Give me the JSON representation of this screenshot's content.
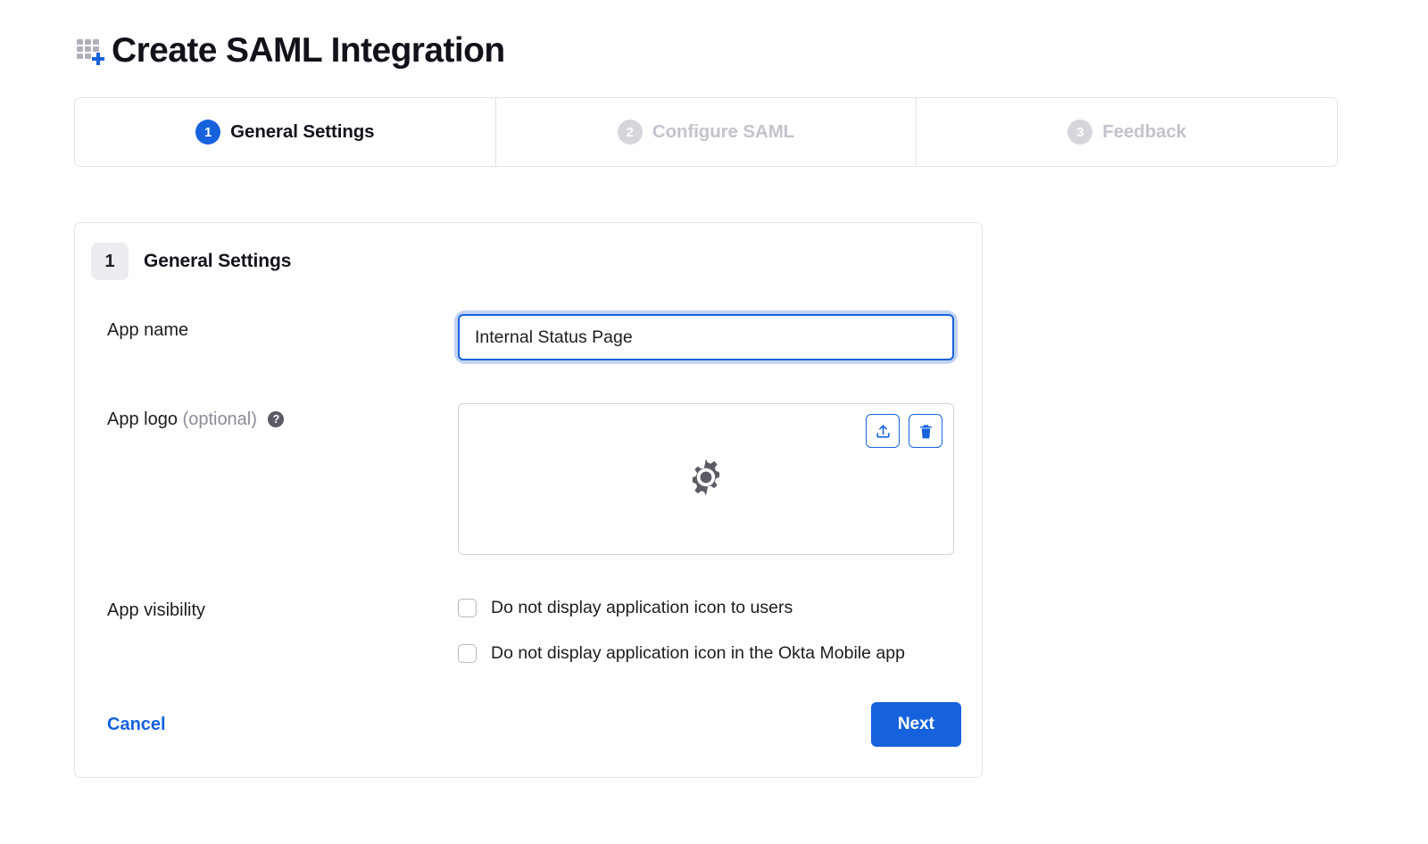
{
  "header": {
    "icon": "app-add-grid-icon",
    "title": "Create SAML Integration"
  },
  "stepper": {
    "tabs": [
      {
        "number": "1",
        "label": "General Settings",
        "active": true
      },
      {
        "number": "2",
        "label": "Configure SAML",
        "active": false
      },
      {
        "number": "3",
        "label": "Feedback",
        "active": false
      }
    ]
  },
  "card": {
    "step_number": "1",
    "step_title": "General Settings",
    "app_name": {
      "label": "App name",
      "value": "Internal Status Page",
      "placeholder": ""
    },
    "app_logo": {
      "label": "App logo",
      "optional_text": "(optional)",
      "help_icon": "help-circle-icon",
      "help_glyph": "?",
      "upload_icon": "upload-icon",
      "delete_icon": "trash-icon",
      "placeholder_icon": "gear-icon"
    },
    "app_visibility": {
      "label": "App visibility",
      "options": [
        {
          "label": "Do not display application icon to users",
          "checked": false
        },
        {
          "label": "Do not display application icon in the Okta Mobile app",
          "checked": false
        }
      ]
    },
    "footer": {
      "cancel_label": "Cancel",
      "next_label": "Next"
    }
  },
  "colors": {
    "accent_blue": "#1662dd",
    "focus_ring": "#c3d3f4",
    "border_gray": "#e3e3e8",
    "muted_text": "#c3c3cc"
  }
}
